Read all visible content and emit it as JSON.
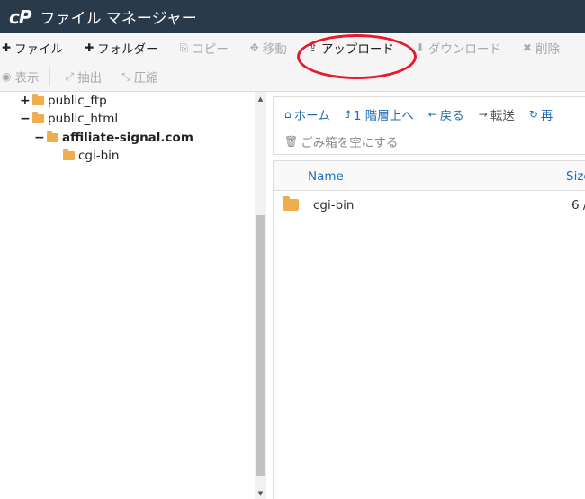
{
  "app": {
    "logo": "cP",
    "title": "ファイル マネージャー"
  },
  "toolbar": {
    "row1": [
      {
        "name": "new-file-button",
        "icon": "plus-icon",
        "glyph": "✚",
        "label": "ファイル",
        "enabled": true
      },
      {
        "name": "new-folder-button",
        "icon": "plus-icon",
        "glyph": "✚",
        "label": "フォルダー",
        "enabled": true
      },
      {
        "name": "copy-button",
        "icon": "copy-icon",
        "glyph": "⎘",
        "label": "コピー",
        "enabled": false
      },
      {
        "name": "move-button",
        "icon": "move-icon",
        "glyph": "✥",
        "label": "移動",
        "enabled": false
      },
      {
        "name": "upload-button",
        "icon": "upload-icon",
        "glyph": "⇪",
        "label": "アップロード",
        "enabled": true
      },
      {
        "name": "download-button",
        "icon": "download-icon",
        "glyph": "⬇",
        "label": "ダウンロード",
        "enabled": false
      },
      {
        "name": "delete-button",
        "icon": "times-icon",
        "glyph": "✖",
        "label": "削除",
        "enabled": false
      }
    ],
    "row2": [
      {
        "name": "view-button",
        "icon": "eye-icon",
        "glyph": "◉",
        "label": "表示",
        "enabled": false
      },
      {
        "name": "extract-button",
        "icon": "expand-icon",
        "glyph": "⤢",
        "label": "抽出",
        "enabled": false
      },
      {
        "name": "compress-button",
        "icon": "compress-icon",
        "glyph": "⤡",
        "label": "圧縮",
        "enabled": false
      }
    ]
  },
  "tree": {
    "items": [
      {
        "name": "tree-item-public-ftp",
        "toggle": "+",
        "label": "public_ftp",
        "bold": false,
        "level": 0
      },
      {
        "name": "tree-item-public-html",
        "toggle": "−",
        "label": "public_html",
        "bold": false,
        "level": 0
      },
      {
        "name": "tree-item-affiliate-signal",
        "toggle": "−",
        "label": "affiliate-signal.com",
        "bold": true,
        "level": 1
      },
      {
        "name": "tree-item-cgi-bin",
        "toggle": "",
        "label": "cgi-bin",
        "bold": false,
        "level": 2
      }
    ]
  },
  "nav": {
    "home": {
      "icon": "home-icon",
      "glyph": "⌂",
      "label": "ホーム"
    },
    "up": {
      "icon": "level-up-icon",
      "glyph": "⮥",
      "label": "1 階層上へ"
    },
    "back": {
      "icon": "arrow-left-icon",
      "glyph": "←",
      "label": "戻る"
    },
    "forward": {
      "icon": "arrow-right-icon",
      "glyph": "→",
      "label": "転送"
    },
    "reload": {
      "icon": "refresh-icon",
      "glyph": "↻",
      "label": "再"
    },
    "trash": {
      "icon": "trash-icon",
      "glyph": "🗑",
      "label": "ごみ箱を空にする"
    }
  },
  "table": {
    "columns": [
      "Name",
      "Size"
    ],
    "rows": [
      {
        "name": "cgi-bin",
        "size": "6 /"
      }
    ]
  },
  "annotation": {
    "color": "#e8192c"
  }
}
